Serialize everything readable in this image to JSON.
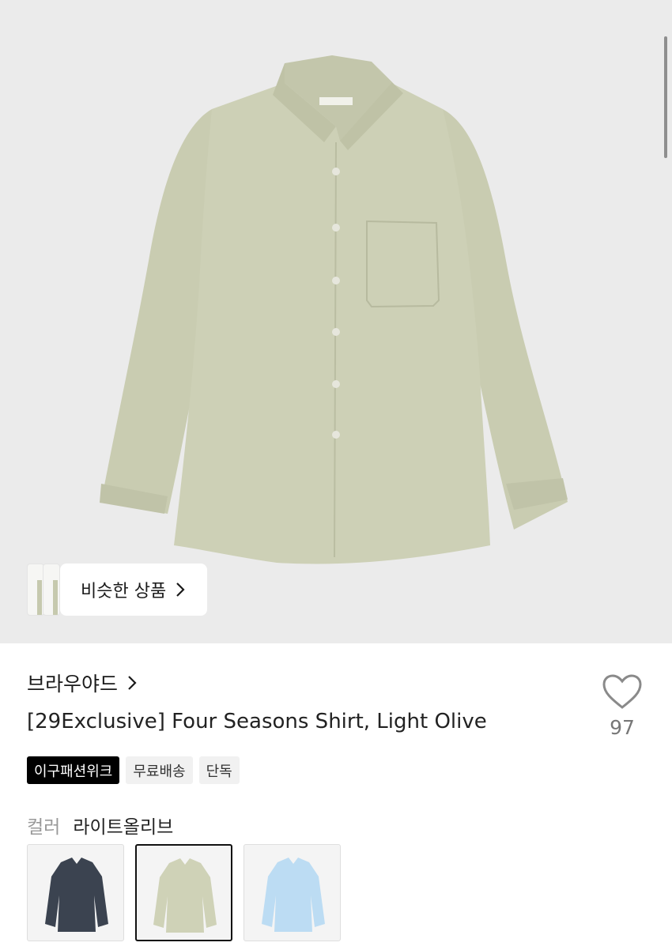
{
  "product_image": {
    "icon": "shirt-image",
    "color": "#cccfb5"
  },
  "similar_products": {
    "label": "비슷한 상품",
    "icon": "chevron-right-icon"
  },
  "brand": {
    "name": "브라우야드",
    "icon": "chevron-right-icon"
  },
  "product": {
    "title": "[29Exclusive] Four Seasons Shirt, Light Olive"
  },
  "like": {
    "icon": "heart-icon",
    "count": "97"
  },
  "tags": [
    "이구패션위크",
    "무료배송",
    "단독"
  ],
  "color_option": {
    "label": "컬러",
    "selected": "라이트올리브",
    "swatches": [
      {
        "name": "navy",
        "color": "#3b4350"
      },
      {
        "name": "light-olive",
        "color": "#cfd2b7"
      },
      {
        "name": "light-blue",
        "color": "#bcdcf3"
      }
    ]
  },
  "colors": {
    "accent_dark": "#000000",
    "tag_light_bg": "#f1f1f1",
    "muted_text": "#777777"
  }
}
